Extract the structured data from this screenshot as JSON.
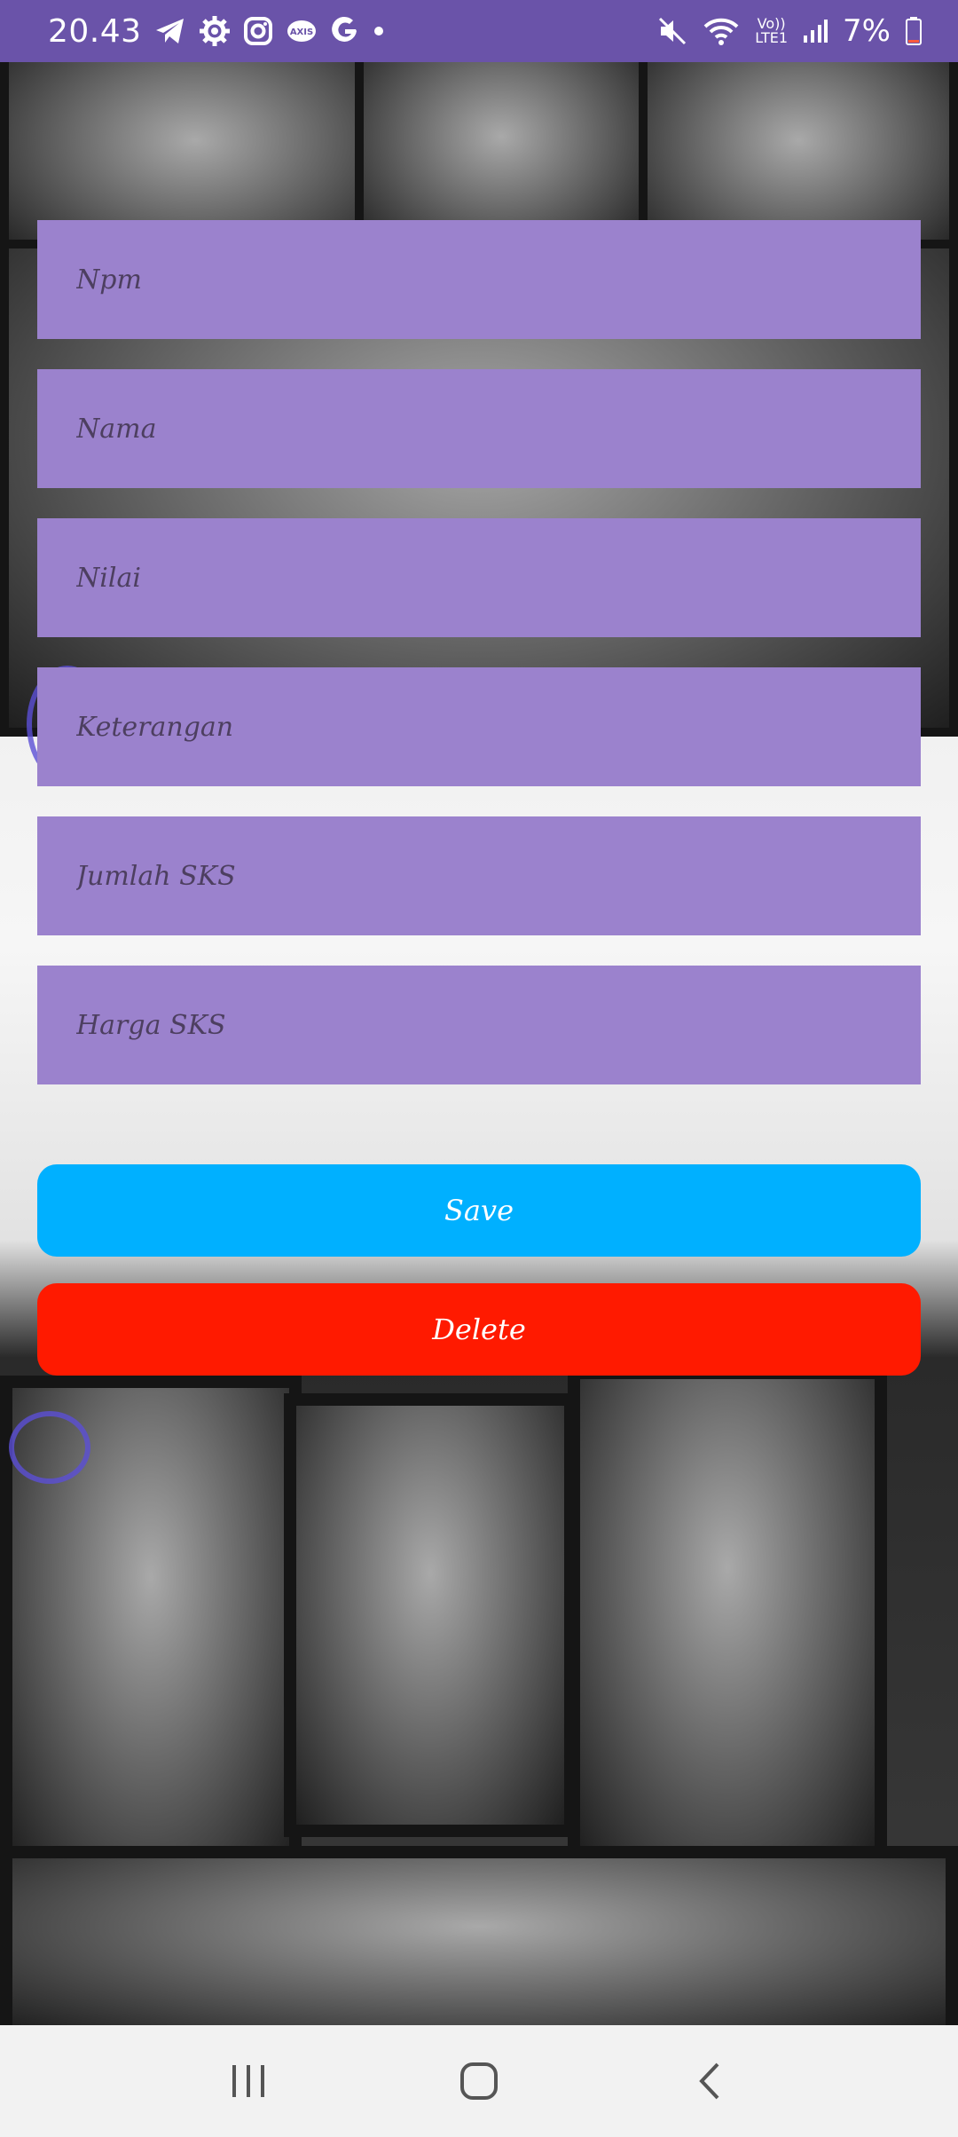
{
  "status_bar": {
    "time": "20.43",
    "battery": "7%",
    "network": "LTE1",
    "icons": [
      "telegram-icon",
      "gear-icon",
      "instagram-icon",
      "axis-icon",
      "google-icon",
      "dot-icon",
      "mute-icon",
      "wifi-icon",
      "volte-icon",
      "signal-icon",
      "battery-icon"
    ]
  },
  "form": {
    "npm": {
      "placeholder": "Npm",
      "value": ""
    },
    "nama": {
      "placeholder": "Nama",
      "value": ""
    },
    "nilai": {
      "placeholder": "Nilai",
      "value": ""
    },
    "keterangan": {
      "placeholder": "Keterangan",
      "value": ""
    },
    "jumlah_sks": {
      "placeholder": "Jumlah SKS",
      "value": ""
    },
    "harga_sks": {
      "placeholder": "Harga SKS",
      "value": ""
    }
  },
  "buttons": {
    "save": "Save",
    "delete": "Delete"
  },
  "colors": {
    "status_bar": "#6a53a9",
    "field": "#9b82cd",
    "field_text": "#4d3f60",
    "save": "#00b0ff",
    "delete": "#ff1a00",
    "nav_bar": "#f2f2f2"
  },
  "nav": {
    "icons": [
      "recent-apps-icon",
      "home-icon",
      "back-icon"
    ]
  }
}
